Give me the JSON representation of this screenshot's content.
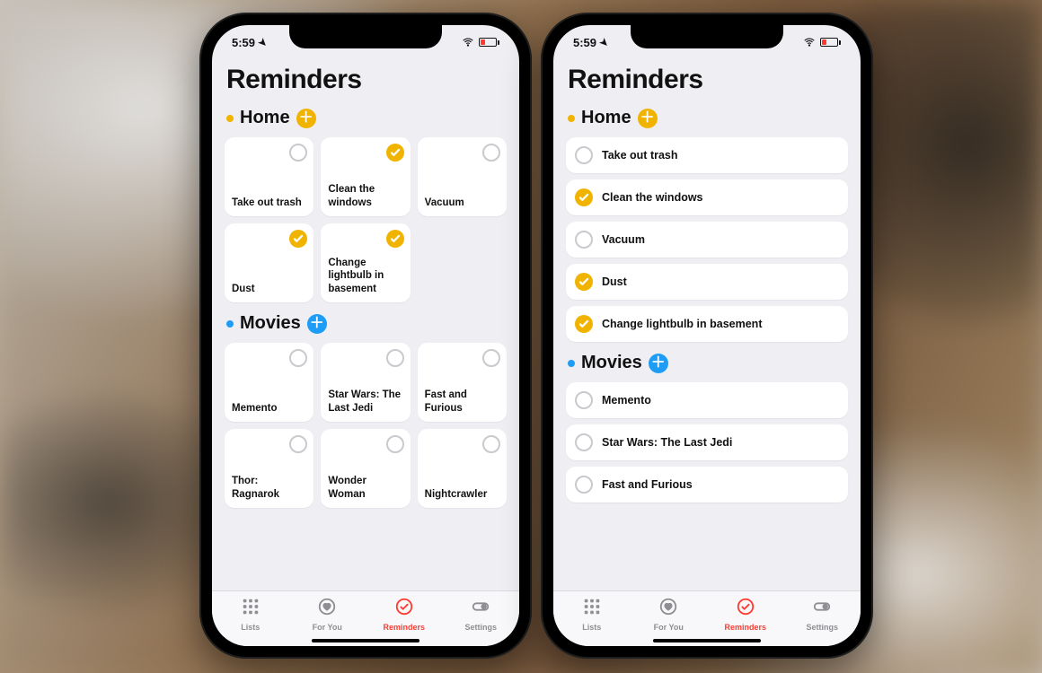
{
  "status": {
    "time": "5:59",
    "location_icon": "location-arrow",
    "wifi": true,
    "battery_low": true
  },
  "page_title": "Reminders",
  "colors": {
    "home": "#f0b400",
    "movies": "#1e9df7",
    "active_tab": "#ff3b30"
  },
  "lists": [
    {
      "key": "home",
      "name": "Home",
      "color": "#f0b400",
      "items": [
        {
          "label": "Take out trash",
          "done": false
        },
        {
          "label": "Clean the windows",
          "done": true
        },
        {
          "label": "Vacuum",
          "done": false
        },
        {
          "label": "Dust",
          "done": true
        },
        {
          "label": "Change lightbulb in basement",
          "done": true
        }
      ]
    },
    {
      "key": "movies",
      "name": "Movies",
      "color": "#1e9df7",
      "items": [
        {
          "label": "Memento",
          "done": false
        },
        {
          "label": "Star Wars: The Last Jedi",
          "done": false
        },
        {
          "label": "Fast and Furious",
          "done": false
        },
        {
          "label": "Thor: Ragnarok",
          "done": false
        },
        {
          "label": "Wonder Woman",
          "done": false
        },
        {
          "label": "Nightcrawler",
          "done": false
        }
      ]
    }
  ],
  "tabs": [
    {
      "key": "lists",
      "label": "Lists",
      "icon": "grid-icon",
      "active": false
    },
    {
      "key": "foryou",
      "label": "For You",
      "icon": "heart-icon",
      "active": false
    },
    {
      "key": "reminders",
      "label": "Reminders",
      "icon": "check-icon",
      "active": true
    },
    {
      "key": "settings",
      "label": "Settings",
      "icon": "toggle-icon",
      "active": false
    }
  ]
}
